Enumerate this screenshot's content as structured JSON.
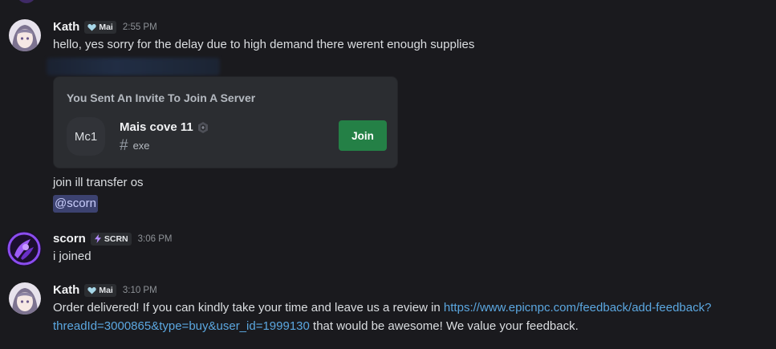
{
  "messages": [
    {
      "username": "Kath",
      "tag": "Mai",
      "timestamp": "2:55 PM",
      "text": "hello, yes sorry for the delay due to high demand there werent enough supplies"
    },
    {
      "text_1": "join ill transfer os",
      "mention": "@scorn"
    },
    {
      "username": "scorn",
      "tag": "SCRN",
      "timestamp": "3:06 PM",
      "text": "i joined"
    },
    {
      "username": "Kath",
      "tag": "Mai",
      "timestamp": "3:10 PM",
      "text_before_link": "Order delivered! If you can kindly take your time and leave us a review in ",
      "link_line1": "https://www.epicnpc.com/feedback/add-feedback?",
      "link_line2": "threadId=3000865&type=buy&user_id=1999130",
      "text_after_link": " that would be awesome! We value your feedback."
    }
  ],
  "invite": {
    "heading": "You Sent An Invite To Join A Server",
    "server_initials": "Mc1",
    "server_name": "Mais cove 11",
    "channel": "exe",
    "join_label": "Join"
  },
  "colors": {
    "background": "#1a1a1e",
    "join_button": "#248046",
    "link": "#5ba7e0",
    "mention_bg": "#3c4270"
  },
  "icons": {
    "tag_kath": "heart-shield-icon",
    "tag_scorn": "bolt-icon",
    "boost": "boost-icon",
    "channel": "hash-icon"
  }
}
